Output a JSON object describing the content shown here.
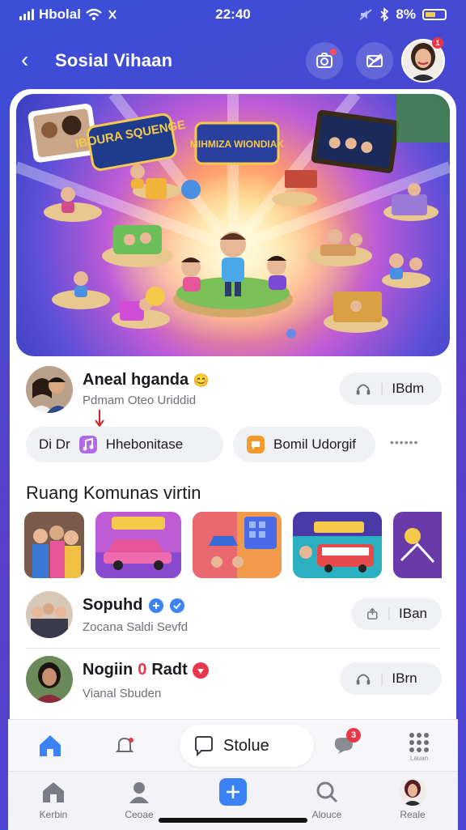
{
  "status_bar": {
    "carrier": "Hbolal",
    "time": "22:40",
    "battery": "8%"
  },
  "header": {
    "title": "Sosial Vihaan",
    "avatar_badge": "1"
  },
  "banner": {
    "title_left": "IBOURA SQUENGE",
    "title_center": "MIHMIZA WIONDIAK"
  },
  "profile": {
    "name": "Aneal hganda",
    "emoji": "😊",
    "subtitle": "Pdmam Oteo Uriddid",
    "button": "IBdm"
  },
  "chips": {
    "first": "Di Dr",
    "second": "Hhebonitase",
    "third": "Bomil Udorgif",
    "more": "••••••"
  },
  "section": {
    "title": "Ruang Komunas virtin"
  },
  "posts": [
    {
      "name": "Sopuhd",
      "subtitle": "Zocana Saldi Sevfd",
      "button": "IBan"
    },
    {
      "name": "Nogiin",
      "number": "0",
      "name2": "Radt",
      "subtitle": "Vianal Sbuden",
      "button": "IBrn"
    }
  ],
  "bottom_bar": {
    "story_label": "Stolue",
    "notif_badge": "3",
    "apps_label": "Lauan"
  },
  "tabs": [
    {
      "label": "Kerbin"
    },
    {
      "label": "Ceoae"
    },
    {
      "label": ""
    },
    {
      "label": "Alouce"
    },
    {
      "label": "Reale"
    }
  ],
  "colors": {
    "accent": "#3b82f6",
    "badge": "#e8364a",
    "purple": "#7c5ce6"
  }
}
